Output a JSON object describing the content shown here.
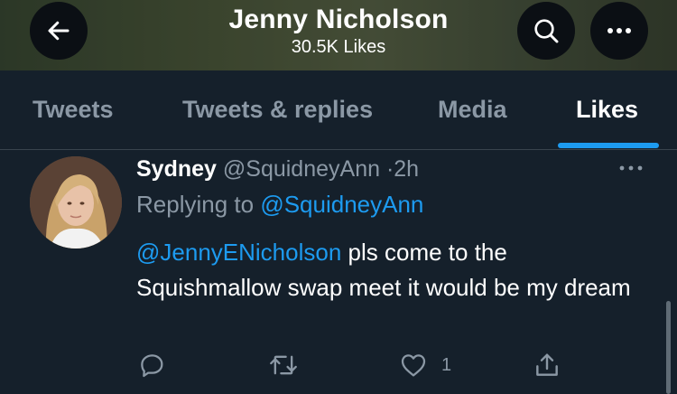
{
  "header": {
    "title": "Jenny Nicholson",
    "subtitle": "30.5K Likes",
    "back_icon": "arrow-left-icon",
    "search_icon": "search-icon",
    "more_icon": "more-horizontal-icon"
  },
  "tabs": [
    {
      "label": "Tweets",
      "active": false
    },
    {
      "label": "Tweets & replies",
      "active": false
    },
    {
      "label": "Media",
      "active": false
    },
    {
      "label": "Likes",
      "active": true
    }
  ],
  "tweet": {
    "author": "Sydney",
    "handle": "@SquidneyAnn",
    "separator": "·",
    "time": "2h",
    "replying_prefix": "Replying to",
    "replying_to": "@SquidneyAnn",
    "mention": "@JennyENicholson",
    "text": " pls come to the Squishmallow swap meet it would be my dream",
    "actions": {
      "reply_icon": "reply-icon",
      "retweet_icon": "retweet-icon",
      "like_icon": "heart-icon",
      "like_count": "1",
      "share_icon": "share-icon"
    }
  },
  "colors": {
    "background": "#15202b",
    "accent": "#1d9bf0",
    "secondary_text": "#8b98a5",
    "divider": "#38444d"
  }
}
